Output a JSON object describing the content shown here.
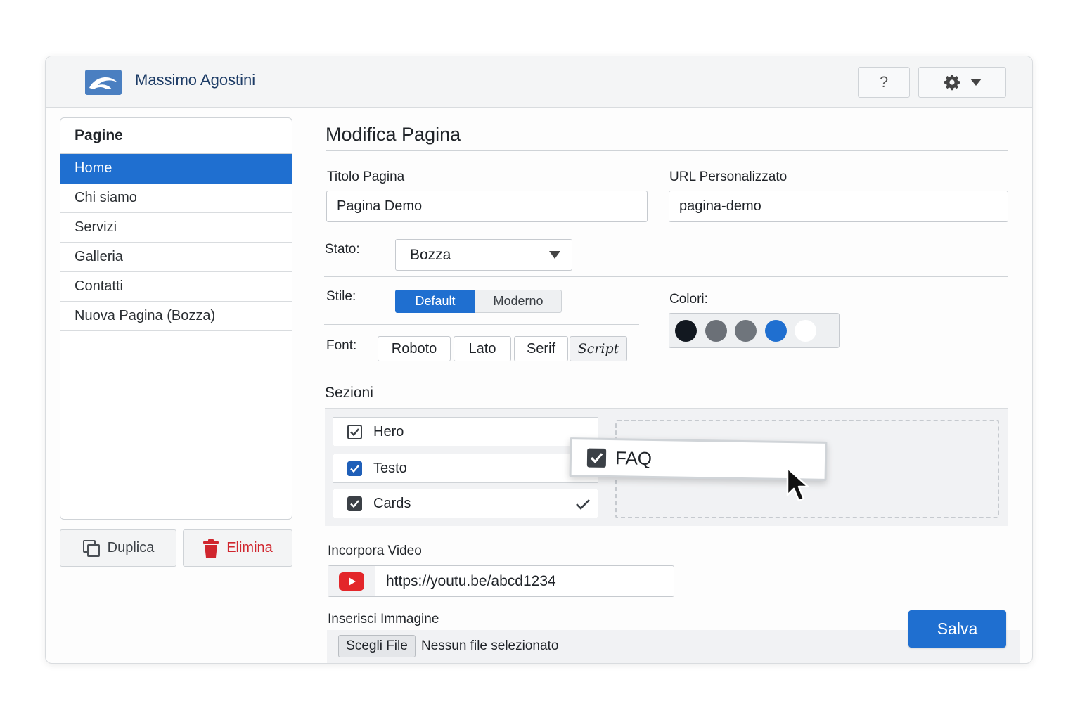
{
  "header": {
    "app_title": "Massimo Agostini",
    "help_label": "?"
  },
  "sidebar": {
    "heading": "Pagine",
    "items": [
      {
        "label": "Home",
        "active": true
      },
      {
        "label": "Chi siamo",
        "active": false
      },
      {
        "label": "Servizi",
        "active": false
      },
      {
        "label": "Galleria",
        "active": false
      },
      {
        "label": "Contatti",
        "active": false
      },
      {
        "label": "Nuova Pagina (Bozza)",
        "active": false
      }
    ],
    "duplicate_label": "Duplica",
    "delete_label": "Elimina"
  },
  "main": {
    "title": "Modifica Pagina",
    "page_title_label": "Titolo Pagina",
    "page_title_value": "Pagina Demo",
    "url_label": "URL Personalizzato",
    "url_value": "pagina-demo",
    "status_label": "Stato:",
    "status_value": "Bozza",
    "style_label": "Stile:",
    "style_options": [
      "Default",
      "Moderno"
    ],
    "style_selected": "Default",
    "font_label": "Font:",
    "font_options": [
      "Roboto",
      "Lato",
      "Serif",
      "Script"
    ],
    "colors_label": "Colori:",
    "colors": [
      "#121820",
      "#6b7077",
      "#6f757c",
      "#1f6fd0",
      "#ffffff"
    ],
    "sections_label": "Sezioni",
    "sections": [
      {
        "label": "Hero",
        "checked": true
      },
      {
        "label": "Testo",
        "checked": true
      },
      {
        "label": "Cards",
        "checked": true
      }
    ],
    "dragged_section": {
      "label": "FAQ",
      "checked": true
    },
    "video_label": "Incorpora Video",
    "video_url": "https://youtu.be/abcd1234",
    "image_label": "Inserisci Immagine",
    "file_button_label": "Scegli File",
    "file_status": "Nessun file selezionato",
    "save_label": "Salva"
  },
  "icons": {
    "logo": "brand-logo-icon",
    "settings": "gear-icon",
    "duplicate": "copy-icon",
    "delete": "trash-icon",
    "video": "youtube-icon",
    "cursor": "mouse-pointer-icon"
  },
  "accent_color": "#1f6fd0",
  "danger_color": "#d0262e"
}
